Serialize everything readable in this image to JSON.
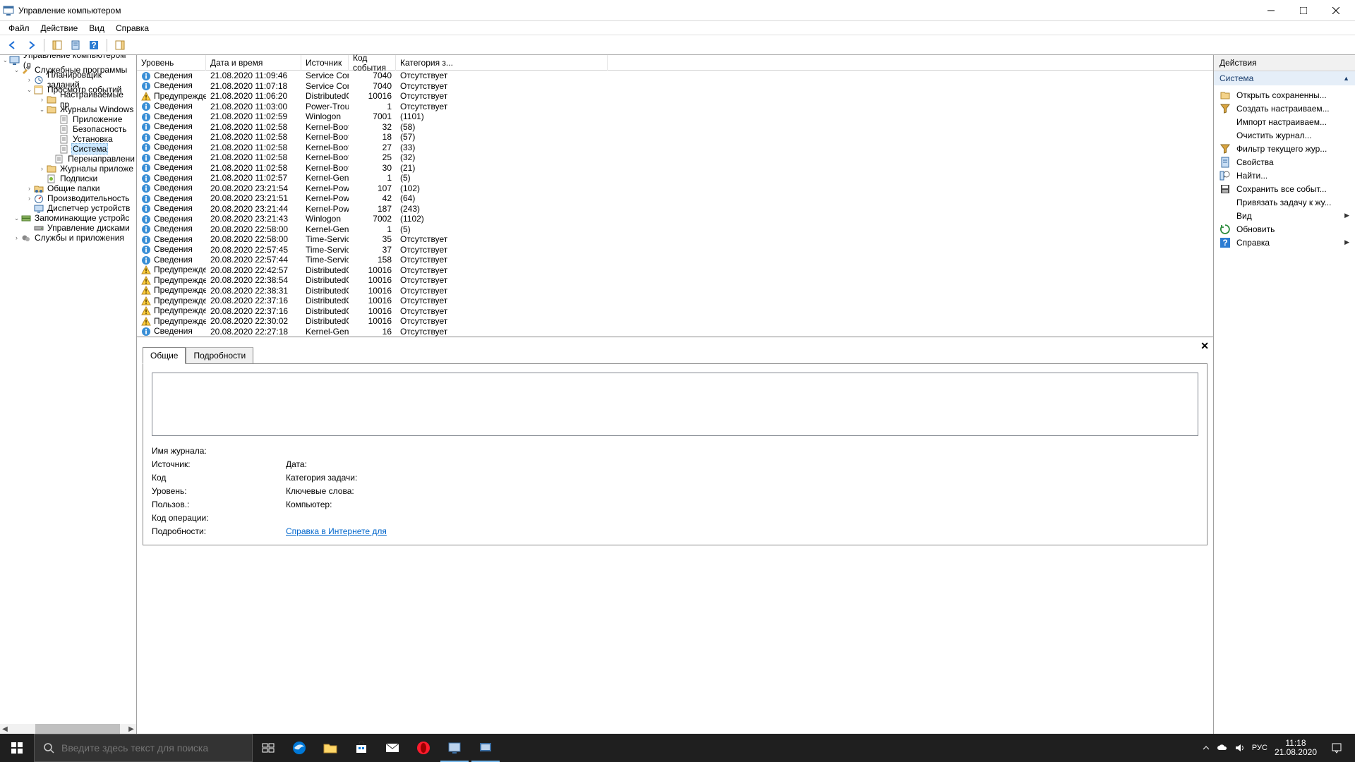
{
  "window": {
    "title": "Управление компьютером"
  },
  "menu": {
    "items": [
      "Файл",
      "Действие",
      "Вид",
      "Справка"
    ]
  },
  "tree": {
    "nodes": [
      {
        "depth": 0,
        "exp": "-",
        "icon": "computer",
        "label": "Управление компьютером (л",
        "selected": false
      },
      {
        "depth": 1,
        "exp": "-",
        "icon": "tools",
        "label": "Служебные программы",
        "selected": false
      },
      {
        "depth": 2,
        "exp": "+",
        "icon": "scheduler",
        "label": "Планировщик заданий",
        "selected": false
      },
      {
        "depth": 2,
        "exp": "-",
        "icon": "eventviewer",
        "label": "Просмотр событий",
        "selected": false
      },
      {
        "depth": 3,
        "exp": "+",
        "icon": "customviews",
        "label": "Настраиваемые пр",
        "selected": false
      },
      {
        "depth": 3,
        "exp": "-",
        "icon": "winlogs",
        "label": "Журналы Windows",
        "selected": false
      },
      {
        "depth": 4,
        "exp": " ",
        "icon": "log",
        "label": "Приложение",
        "selected": false
      },
      {
        "depth": 4,
        "exp": " ",
        "icon": "log",
        "label": "Безопасность",
        "selected": false
      },
      {
        "depth": 4,
        "exp": " ",
        "icon": "log",
        "label": "Установка",
        "selected": false
      },
      {
        "depth": 4,
        "exp": " ",
        "icon": "log",
        "label": "Система",
        "selected": true
      },
      {
        "depth": 4,
        "exp": " ",
        "icon": "log",
        "label": "Перенаправлени",
        "selected": false
      },
      {
        "depth": 3,
        "exp": "+",
        "icon": "applogs",
        "label": "Журналы приложе",
        "selected": false
      },
      {
        "depth": 3,
        "exp": " ",
        "icon": "subscriptions",
        "label": "Подписки",
        "selected": false
      },
      {
        "depth": 2,
        "exp": "+",
        "icon": "sharedfolders",
        "label": "Общие папки",
        "selected": false
      },
      {
        "depth": 2,
        "exp": "+",
        "icon": "perf",
        "label": "Производительность",
        "selected": false
      },
      {
        "depth": 2,
        "exp": " ",
        "icon": "devmgr",
        "label": "Диспетчер устройств",
        "selected": false
      },
      {
        "depth": 1,
        "exp": "-",
        "icon": "storage",
        "label": "Запоминающие устройс",
        "selected": false
      },
      {
        "depth": 2,
        "exp": " ",
        "icon": "diskmgmt",
        "label": "Управление дисками",
        "selected": false
      },
      {
        "depth": 1,
        "exp": "+",
        "icon": "services",
        "label": "Службы и приложения",
        "selected": false
      }
    ]
  },
  "list": {
    "headers": {
      "level": "Уровень",
      "date": "Дата и время",
      "source": "Источник",
      "eventid": "Код события",
      "category": "Категория з..."
    },
    "level_info": "Сведения",
    "level_warn": "Предупреждение",
    "cat_none": "Отсутствует",
    "rows": [
      {
        "lvl": "info",
        "date": "21.08.2020 11:09:46",
        "src": "Service Cont...",
        "id": "7040",
        "cat": "none"
      },
      {
        "lvl": "info",
        "date": "21.08.2020 11:07:18",
        "src": "Service Cont...",
        "id": "7040",
        "cat": "none"
      },
      {
        "lvl": "warn",
        "date": "21.08.2020 11:06:20",
        "src": "DistributedC...",
        "id": "10016",
        "cat": "none"
      },
      {
        "lvl": "info",
        "date": "21.08.2020 11:03:00",
        "src": "Power-Trou...",
        "id": "1",
        "cat": "none"
      },
      {
        "lvl": "info",
        "date": "21.08.2020 11:02:59",
        "src": "Winlogon",
        "id": "7001",
        "cat": "(1101)"
      },
      {
        "lvl": "info",
        "date": "21.08.2020 11:02:58",
        "src": "Kernel-Boot",
        "id": "32",
        "cat": "(58)"
      },
      {
        "lvl": "info",
        "date": "21.08.2020 11:02:58",
        "src": "Kernel-Boot",
        "id": "18",
        "cat": "(57)"
      },
      {
        "lvl": "info",
        "date": "21.08.2020 11:02:58",
        "src": "Kernel-Boot",
        "id": "27",
        "cat": "(33)"
      },
      {
        "lvl": "info",
        "date": "21.08.2020 11:02:58",
        "src": "Kernel-Boot",
        "id": "25",
        "cat": "(32)"
      },
      {
        "lvl": "info",
        "date": "21.08.2020 11:02:58",
        "src": "Kernel-Boot",
        "id": "30",
        "cat": "(21)"
      },
      {
        "lvl": "info",
        "date": "21.08.2020 11:02:57",
        "src": "Kernel-Gene...",
        "id": "1",
        "cat": "(5)"
      },
      {
        "lvl": "info",
        "date": "20.08.2020 23:21:54",
        "src": "Kernel-Power",
        "id": "107",
        "cat": "(102)"
      },
      {
        "lvl": "info",
        "date": "20.08.2020 23:21:51",
        "src": "Kernel-Power",
        "id": "42",
        "cat": "(64)"
      },
      {
        "lvl": "info",
        "date": "20.08.2020 23:21:44",
        "src": "Kernel-Power",
        "id": "187",
        "cat": "(243)"
      },
      {
        "lvl": "info",
        "date": "20.08.2020 23:21:43",
        "src": "Winlogon",
        "id": "7002",
        "cat": "(1102)"
      },
      {
        "lvl": "info",
        "date": "20.08.2020 22:58:00",
        "src": "Kernel-Gene...",
        "id": "1",
        "cat": "(5)"
      },
      {
        "lvl": "info",
        "date": "20.08.2020 22:58:00",
        "src": "Time-Service",
        "id": "35",
        "cat": "none"
      },
      {
        "lvl": "info",
        "date": "20.08.2020 22:57:45",
        "src": "Time-Service",
        "id": "37",
        "cat": "none"
      },
      {
        "lvl": "info",
        "date": "20.08.2020 22:57:44",
        "src": "Time-Service",
        "id": "158",
        "cat": "none"
      },
      {
        "lvl": "warn",
        "date": "20.08.2020 22:42:57",
        "src": "DistributedC...",
        "id": "10016",
        "cat": "none"
      },
      {
        "lvl": "warn",
        "date": "20.08.2020 22:38:54",
        "src": "DistributedC...",
        "id": "10016",
        "cat": "none"
      },
      {
        "lvl": "warn",
        "date": "20.08.2020 22:38:31",
        "src": "DistributedC...",
        "id": "10016",
        "cat": "none"
      },
      {
        "lvl": "warn",
        "date": "20.08.2020 22:37:16",
        "src": "DistributedC...",
        "id": "10016",
        "cat": "none"
      },
      {
        "lvl": "warn",
        "date": "20.08.2020 22:37:16",
        "src": "DistributedC...",
        "id": "10016",
        "cat": "none"
      },
      {
        "lvl": "warn",
        "date": "20.08.2020 22:30:02",
        "src": "DistributedC...",
        "id": "10016",
        "cat": "none"
      },
      {
        "lvl": "info",
        "date": "20.08.2020 22:27:18",
        "src": "Kernel-Gene...",
        "id": "16",
        "cat": "none"
      }
    ]
  },
  "detail": {
    "tabs": {
      "general": "Общие",
      "details": "Подробности"
    },
    "close": "✕",
    "labels": {
      "logname": "Имя журнала:",
      "source": "Источник:",
      "date": "Дата:",
      "eventid": "Код",
      "category": "Категория задачи:",
      "level": "Уровень:",
      "keywords": "Ключевые слова:",
      "user": "Пользов.:",
      "computer": "Компьютер:",
      "opcode": "Код операции:",
      "moreinfo": "Подробности:"
    },
    "helplink": "Справка в Интернете для "
  },
  "actions": {
    "title": "Действия",
    "section": "Система",
    "items": [
      {
        "icon": "open",
        "label": "Открыть сохраненны...",
        "chev": false
      },
      {
        "icon": "funnel",
        "label": "Создать настраиваем...",
        "chev": false
      },
      {
        "icon": "blank",
        "label": "Импорт настраиваем...",
        "chev": false
      },
      {
        "icon": "blank",
        "label": "Очистить журнал...",
        "chev": false
      },
      {
        "icon": "funnel",
        "label": "Фильтр текущего жур...",
        "chev": false
      },
      {
        "icon": "props",
        "label": "Свойства",
        "chev": false
      },
      {
        "icon": "find",
        "label": "Найти...",
        "chev": false
      },
      {
        "icon": "save",
        "label": "Сохранить все событ...",
        "chev": false
      },
      {
        "icon": "blank",
        "label": "Привязать задачу к жу...",
        "chev": false
      },
      {
        "icon": "blank",
        "label": "Вид",
        "chev": true
      },
      {
        "icon": "refresh",
        "label": "Обновить",
        "chev": false
      },
      {
        "icon": "help",
        "label": "Справка",
        "chev": true
      }
    ]
  },
  "taskbar": {
    "search_placeholder": "Введите здесь текст для поиска",
    "lang": "РУС",
    "time": "11:18",
    "date": "21.08.2020"
  }
}
